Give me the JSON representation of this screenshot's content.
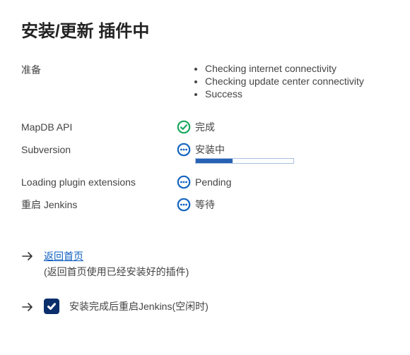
{
  "title": "安装/更新 插件中",
  "preparation": {
    "label": "准备",
    "items": [
      "Checking internet connectivity",
      "Checking update center connectivity",
      "Success"
    ]
  },
  "tasks": [
    {
      "name": "MapDB API",
      "status_text": "完成",
      "state": "success"
    },
    {
      "name": "Subversion",
      "status_text": "安装中",
      "state": "progress",
      "progress_pct": 38
    },
    {
      "name": "Loading plugin extensions",
      "status_text": "Pending",
      "state": "pending"
    },
    {
      "name": "重启 Jenkins",
      "status_text": "等待",
      "state": "pending"
    }
  ],
  "footer": {
    "back_link": "返回首页",
    "back_hint": "(返回首页使用已经安装好的插件)",
    "restart_checkbox_label": "安装完成后重启Jenkins(空闲时)",
    "restart_checked": true
  },
  "colors": {
    "success": "#1aa85f",
    "pending": "#1565c0"
  }
}
